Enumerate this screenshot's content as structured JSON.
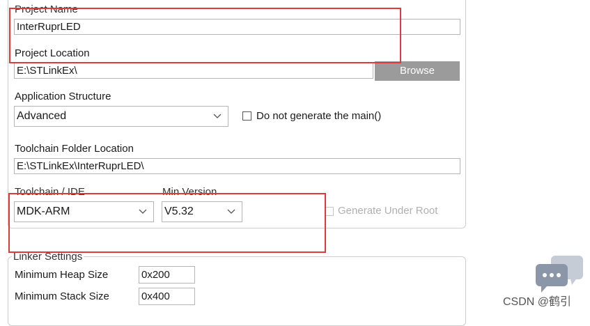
{
  "project": {
    "name_label": "Project Name",
    "name_value": "InterRuprLED",
    "location_label": "Project Location",
    "location_value": "E:\\STLinkEx\\",
    "browse_label": "Browse"
  },
  "application": {
    "structure_label": "Application Structure",
    "structure_value": "Advanced",
    "no_main_label": "Do not generate the main()"
  },
  "toolchain": {
    "folder_label": "Toolchain Folder Location",
    "folder_value": "E:\\STLinkEx\\InterRuprLED\\",
    "ide_label": "Toolchain / IDE",
    "ide_value": "MDK-ARM",
    "min_version_label": "Min Version",
    "min_version_value": "V5.32",
    "under_root_label": "Generate Under Root"
  },
  "linker": {
    "group_label": "Linker Settings",
    "heap_label": "Minimum Heap Size",
    "heap_value": "0x200",
    "stack_label": "Minimum Stack Size",
    "stack_value": "0x400"
  },
  "watermark": {
    "text": "CSDN @鹤引"
  },
  "colors": {
    "annotation": "#e0393a",
    "button": "#9b9b9b"
  }
}
